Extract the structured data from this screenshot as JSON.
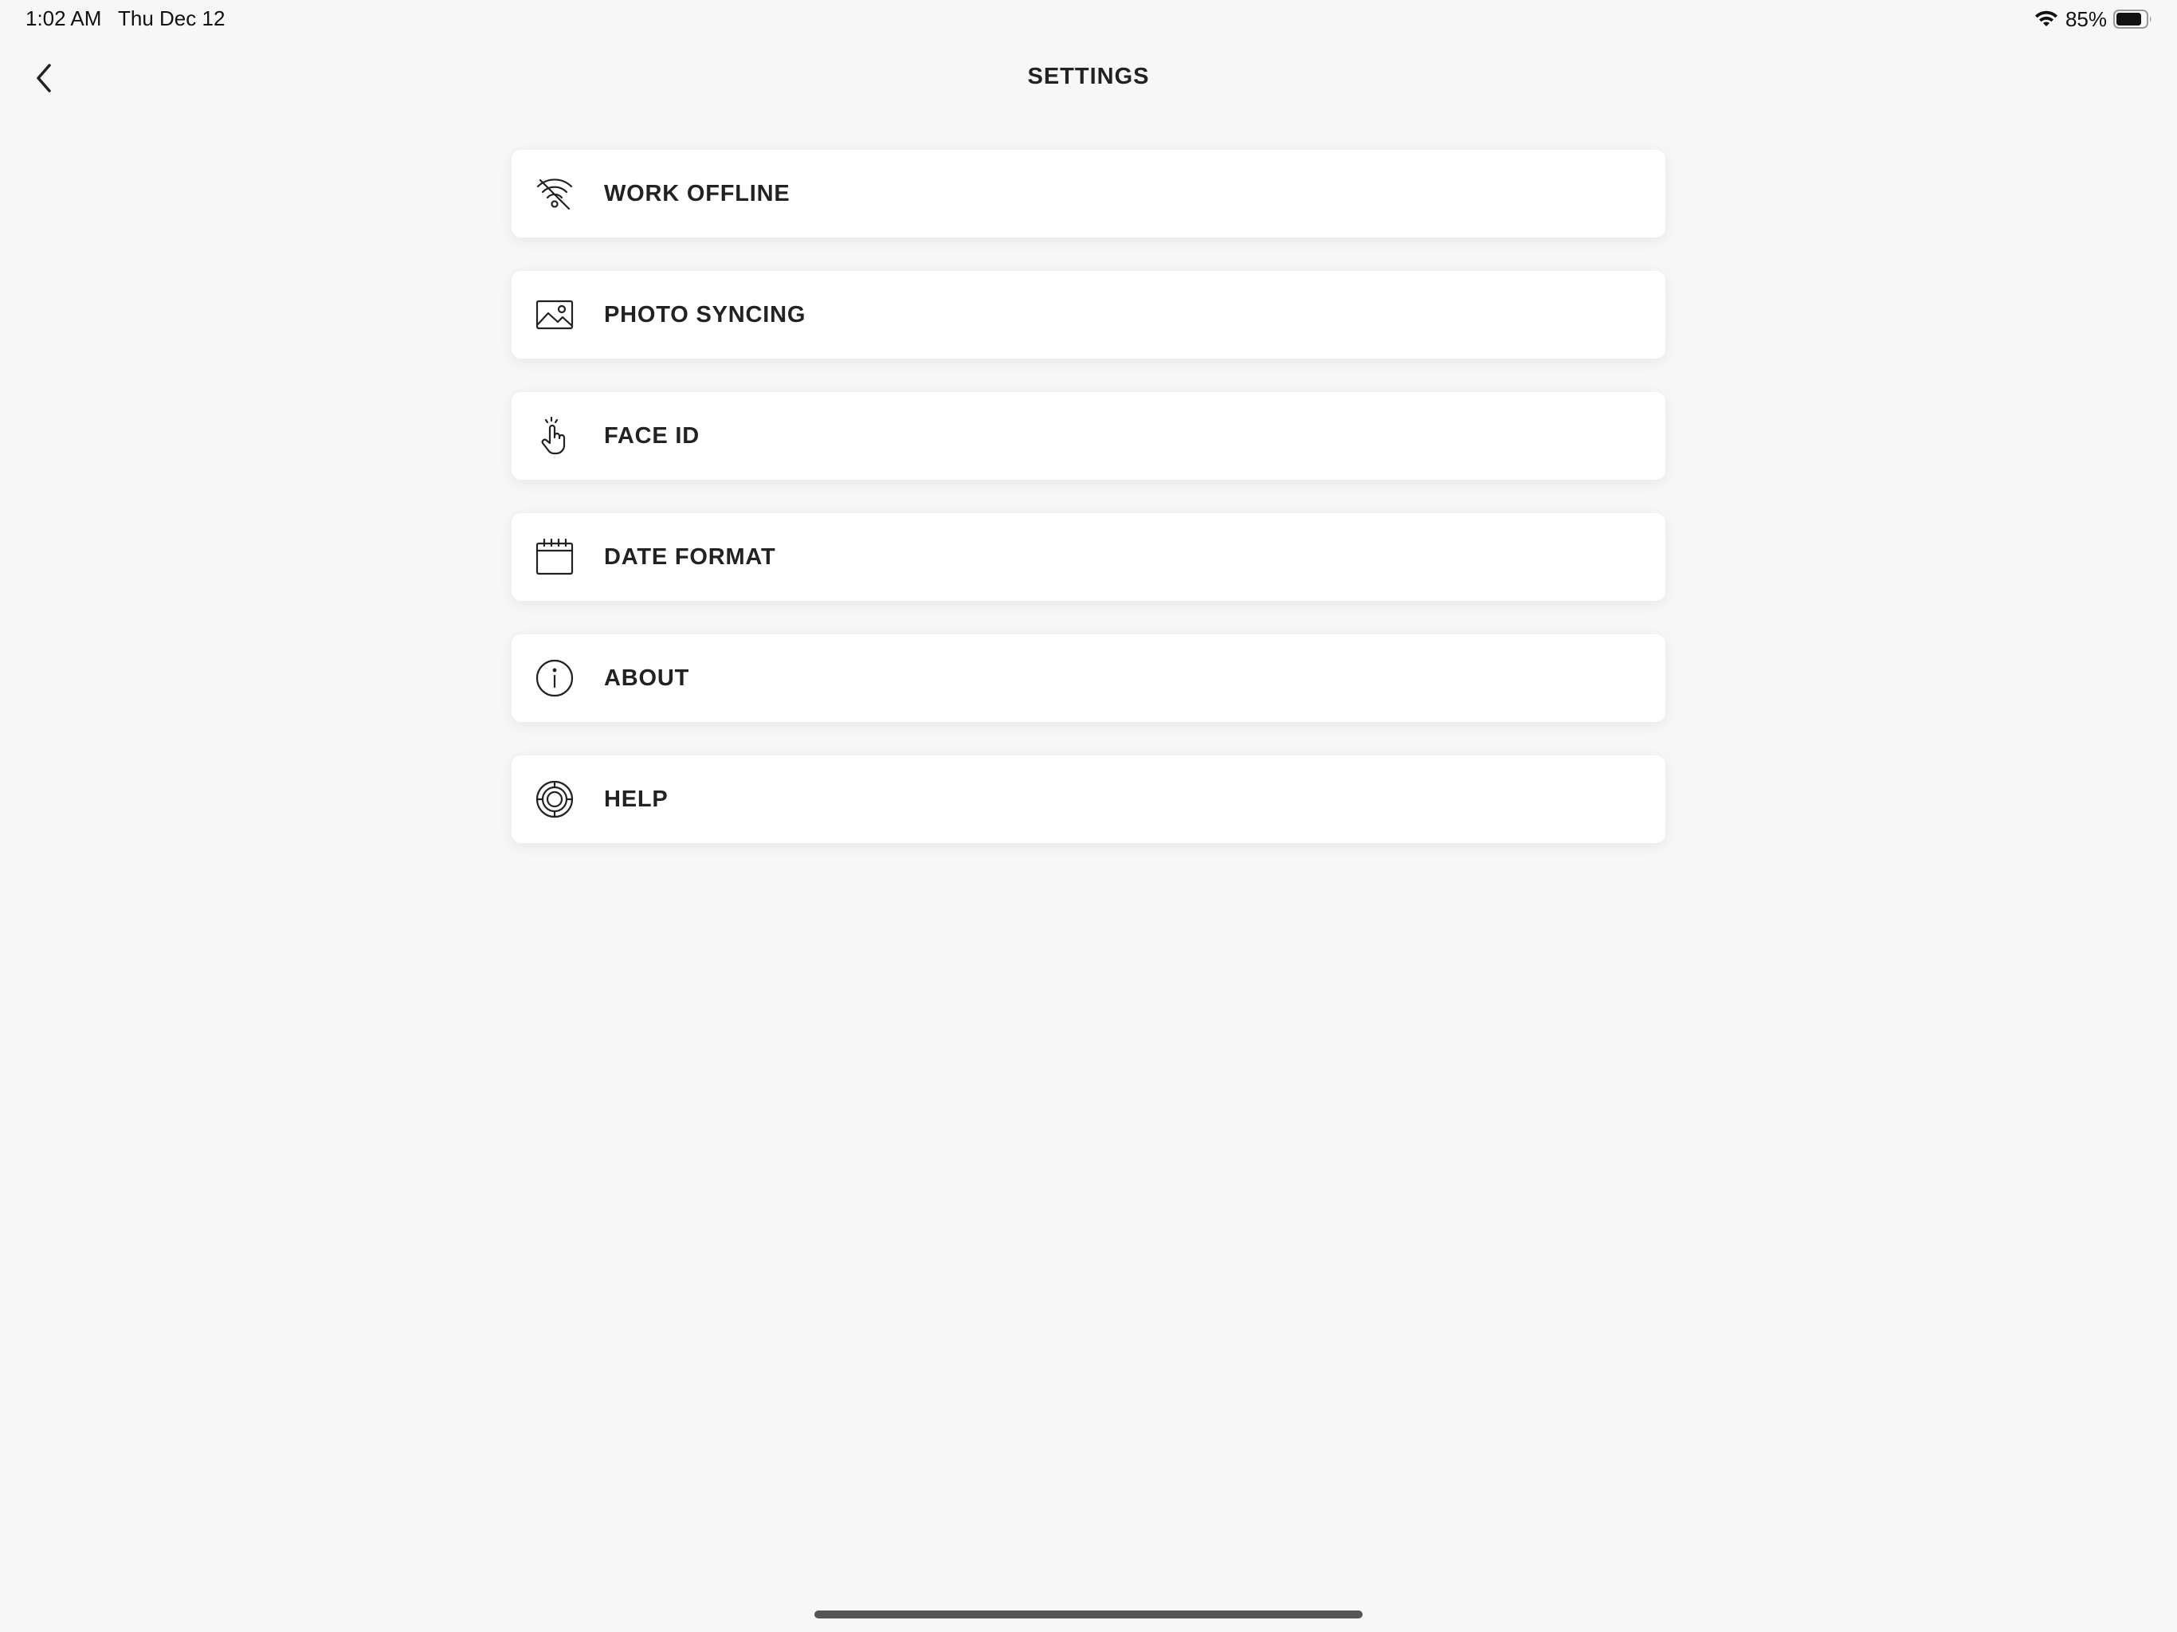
{
  "status_bar": {
    "time": "1:02 AM",
    "date": "Thu Dec 12",
    "battery_percent": "85%",
    "battery_level": 0.85,
    "icons": [
      "wifi-icon",
      "battery-icon"
    ]
  },
  "header": {
    "title": "SETTINGS",
    "back_icon": "chevron-left-icon"
  },
  "settings": {
    "items": [
      {
        "label": "WORK OFFLINE",
        "icon": "wifi-off-icon"
      },
      {
        "label": "PHOTO SYNCING",
        "icon": "image-icon"
      },
      {
        "label": "FACE ID",
        "icon": "touch-hand-icon"
      },
      {
        "label": "DATE FORMAT",
        "icon": "calendar-icon"
      },
      {
        "label": "ABOUT",
        "icon": "info-icon"
      },
      {
        "label": "HELP",
        "icon": "lifebuoy-icon"
      }
    ]
  },
  "colors": {
    "background": "#f7f7f7",
    "card": "#ffffff",
    "text": "#222222",
    "home_indicator": "#555555"
  }
}
